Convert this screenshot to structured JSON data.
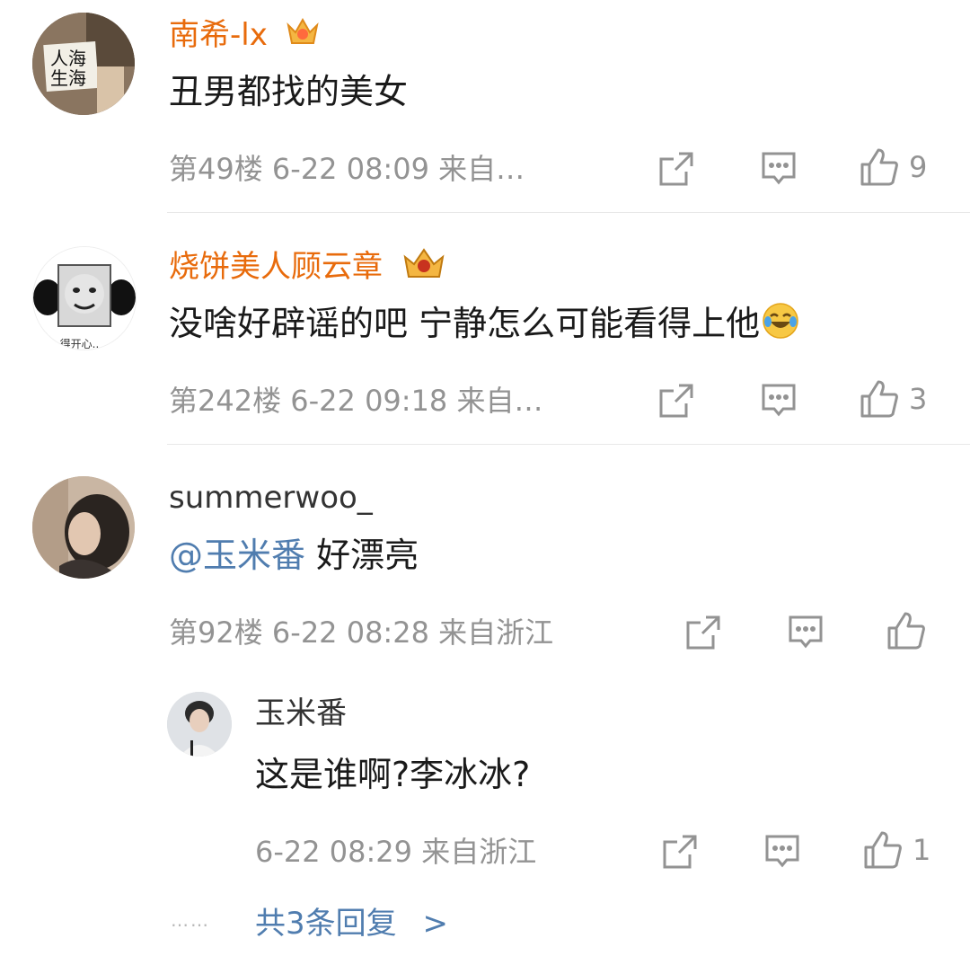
{
  "colors": {
    "vip_name": "#e86b0c",
    "normal_name": "#333333",
    "link": "#507daf",
    "meta": "#939393"
  },
  "comments": [
    {
      "username": "南希-lx",
      "vip": true,
      "text": "丑男都找的美女",
      "floor": "第49楼",
      "time": "6-22 08:09",
      "source": "来自…",
      "likes": "9"
    },
    {
      "username": "烧饼美人顾云章",
      "vip": true,
      "text": "没啥好辟谣的吧 宁静怎么可能看得上他",
      "floor": "第242楼",
      "time": "6-22 09:18",
      "source": "来自…",
      "likes": "3"
    },
    {
      "username": "summerwoo_",
      "vip": false,
      "mention": "@玉米番",
      "text": " 好漂亮",
      "floor": "第92楼",
      "time": "6-22 08:28",
      "source": "来自浙江",
      "likes": ""
    }
  ],
  "reply": {
    "username": "玉米番",
    "text": "这是谁啊?李冰冰?",
    "time": "6-22 08:29",
    "source": "来自浙江",
    "likes": "1"
  },
  "more": {
    "dots": "……",
    "label": "共3条回复",
    "arrow": ">"
  },
  "icons": [
    "repost-icon",
    "comment-icon",
    "like-icon",
    "crown-badge-icon",
    "laugh-cry-emoji-icon",
    "chevron-right-icon"
  ]
}
